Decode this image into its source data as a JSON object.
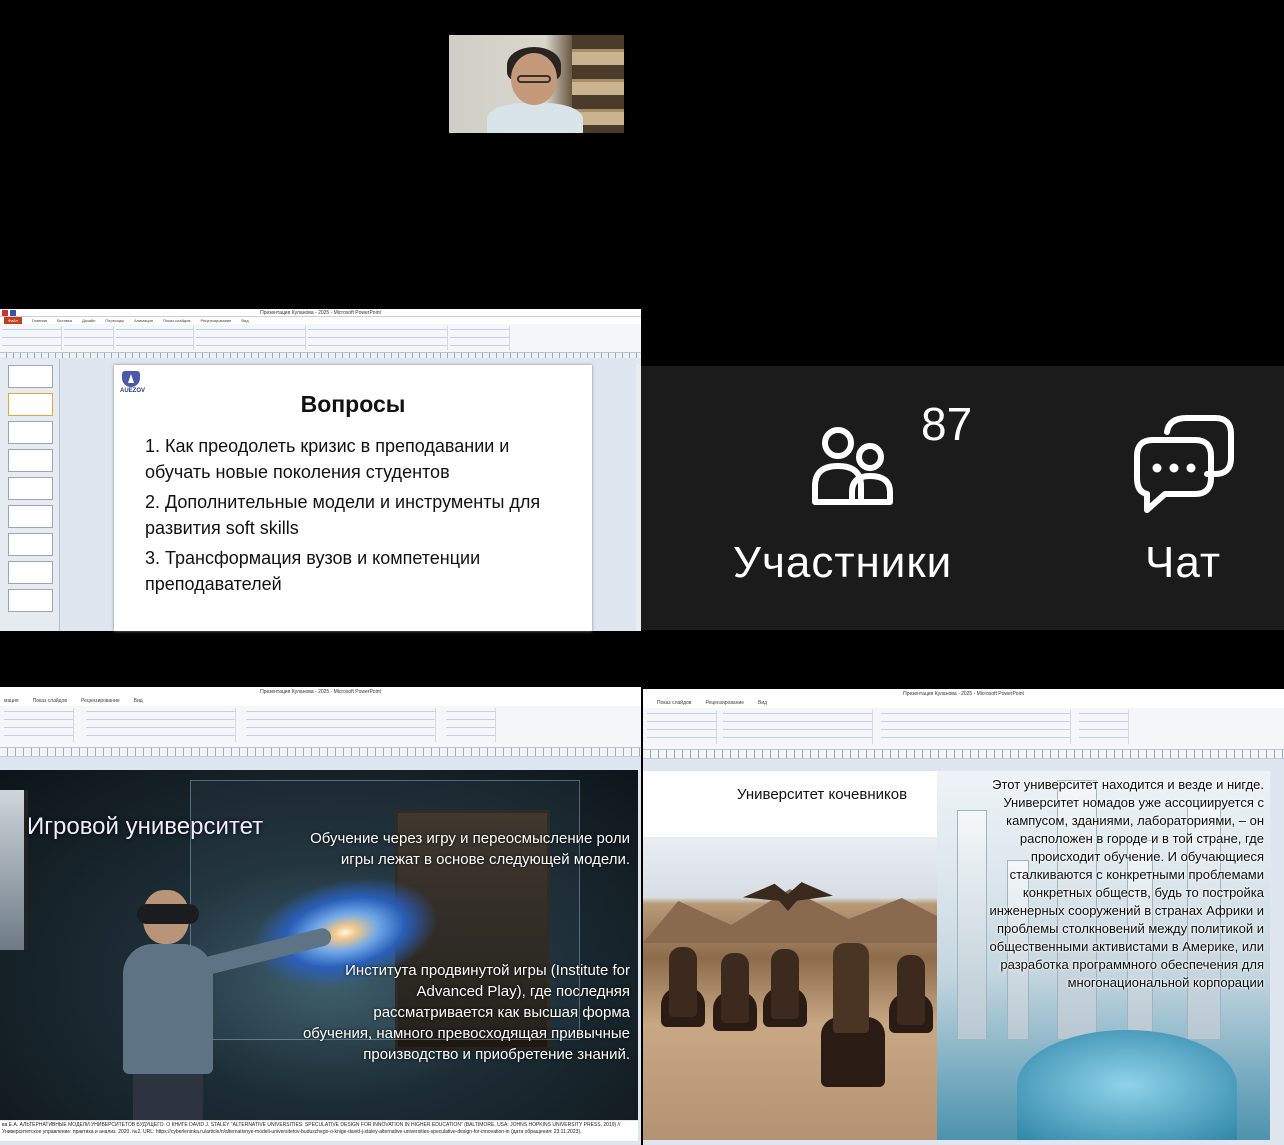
{
  "webcam": {
    "participant": "speaker"
  },
  "editor_top": {
    "window_title": "Презентация Куланова - 2025 - Microsoft PowerPoint",
    "tabs": [
      "Файл",
      "Главная",
      "Вставка",
      "Дизайн",
      "Переходы",
      "Анимация",
      "Показ слайдов",
      "Рецензирование",
      "Вид"
    ],
    "slide": {
      "logo_text": "AUEZOV",
      "title": "Вопросы",
      "items": [
        "1. Как преодолеть кризис в преподавании и обучать новые поколения студентов",
        "2. Дополнительные модели и инструменты для развития soft skills",
        "3. Трансформация вузов и компетенции преподавателей"
      ]
    }
  },
  "call_panel": {
    "participants_count": "87",
    "participants_label": "Участники",
    "chat_label": "Чат",
    "participants_icon": "people-icon",
    "chat_icon": "chat-bubbles-icon"
  },
  "editor_left": {
    "window_title": "Презентация Куланова - 2025 - Microsoft PowerPoint",
    "tabs": [
      "мация",
      "Показ слайдов",
      "Рецензирование",
      "Вид"
    ],
    "slide": {
      "title": "Игровой университет",
      "text1": "Обучение через игру и переосмысление роли игры лежат в основе следующей модели.",
      "text2": "Института продвинутой игры (Institute for Advanced Play), где последняя рассматривается как высшая форма обучения, намного превосходящая привычные производство и приобретение знаний.",
      "footnote": "ва Е.А. АЛЬТЕРНАТИВНЫЕ МОДЕЛИ УНИВЕРСИТЕТОВ БУДУЩЕГО. О КНИГЕ DAVID J. STALEY \"ALTERNATIVE UNIVERSITIES: SPECULATIVE DESIGN FOR INNOVATION IN HIGHER EDUCATION\" (BALTIMORE, USA: JOHNS HOPKINS UNIVERSITY PRESS, 2019) // Университетское управление: практика и анализ. 2020. №2. URL: https://cyberleninka.ru/article/n/alternativnye-modeli-universitetov-buduschego-o-knige-david-j-staley-alternative-universities-speculative-design-for-innovation-in (дата обращения: 23.11.2023)."
    }
  },
  "editor_right": {
    "window_title": "Презентация Куланова - 2025 - Microsoft PowerPoint",
    "tabs": [
      "Показ слайдов",
      "Рецензирование",
      "Вид"
    ],
    "slide": {
      "title": "Университет кочевников",
      "text": "Этот университет находится и везде и нигде. Университет номадов уже ассоциируется с кампусом, зданиями, лабораториями, – он расположен в городе и в той стране, где происходит обучение. И обучающиеся сталкиваются с конкретными проблемами конкретных обществ, будь то постройка инженерных сооружений в странах Африки и проблемы столкновений между политикой и общественными активистами в Америке, или разработка программного обеспечения для многонациональной корпорации"
    }
  }
}
